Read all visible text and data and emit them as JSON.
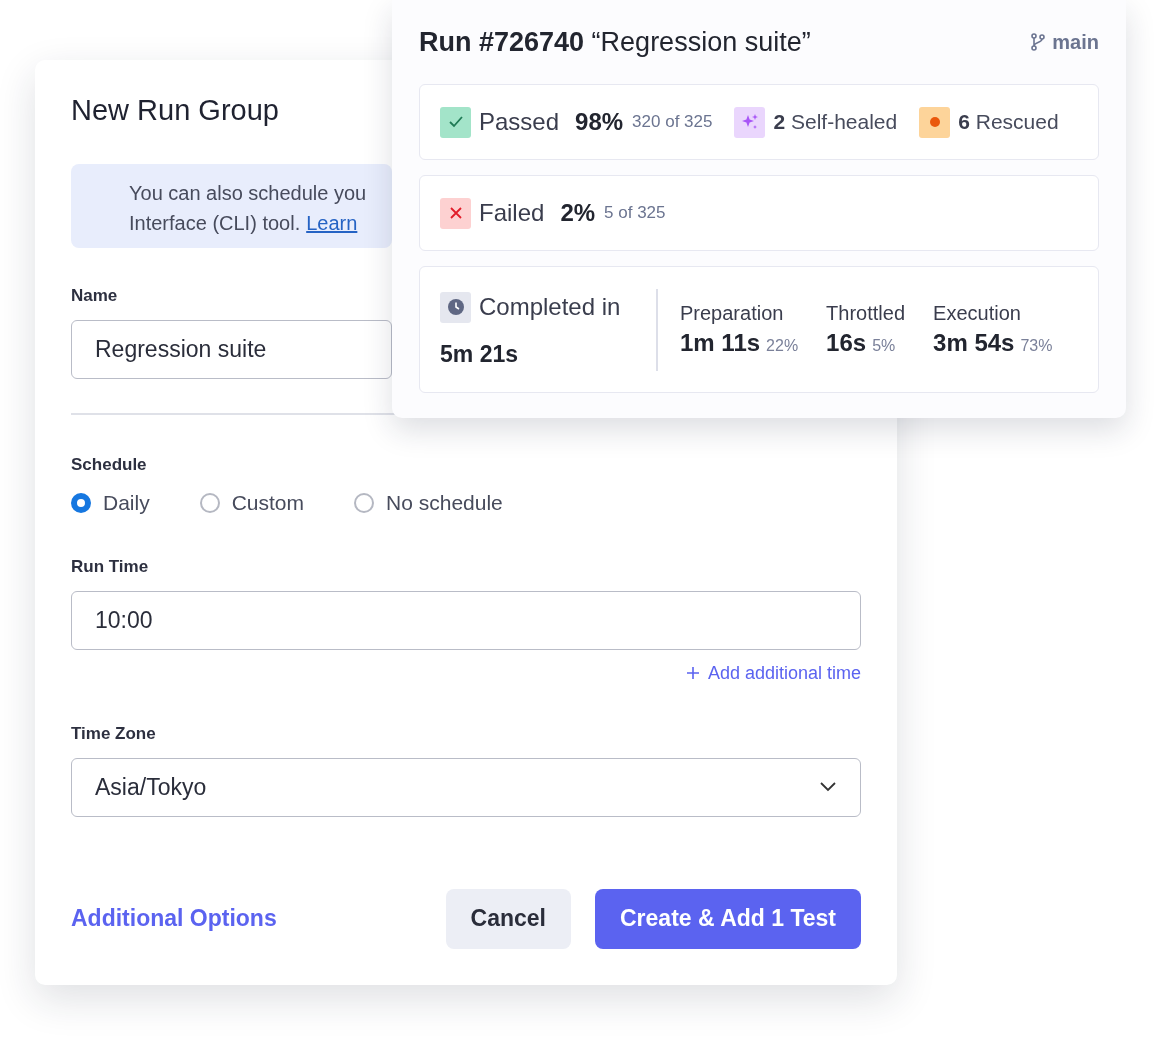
{
  "form": {
    "title": "New Run Group",
    "info": {
      "lines": [
        "You can also schedule you",
        "Interface (CLI) tool."
      ],
      "link": "Learn"
    },
    "name_field": {
      "label": "Name",
      "value": "Regression suite"
    },
    "schedule": {
      "label": "Schedule",
      "options": [
        {
          "label": "Daily",
          "selected": true
        },
        {
          "label": "Custom",
          "selected": false
        },
        {
          "label": "No schedule",
          "selected": false
        }
      ]
    },
    "run_time": {
      "label": "Run Time",
      "value": "10:00",
      "add_link": "Add additional time"
    },
    "time_zone": {
      "label": "Time Zone",
      "value": "Asia/Tokyo"
    },
    "footer": {
      "options_link": "Additional Options",
      "cancel": "Cancel",
      "submit": "Create & Add 1 Test"
    }
  },
  "run_panel": {
    "run": "Run #726740",
    "name": "“Regression suite”",
    "branch": "main",
    "passed": {
      "label": "Passed",
      "percent": "98%",
      "count": "320 of 325",
      "badges": [
        {
          "kind": "self_healed",
          "count": "2",
          "label": "Self-healed"
        },
        {
          "kind": "rescued",
          "count": "6",
          "label": "Rescued"
        }
      ]
    },
    "failed": {
      "label": "Failed",
      "percent": "2%",
      "count": "5 of 325"
    },
    "completed": {
      "label": "Completed in",
      "total": "5m 21s",
      "phases": [
        {
          "label": "Preparation",
          "value": "1m 11s",
          "share": "22%"
        },
        {
          "label": "Throttled",
          "value": "16s",
          "share": "5%"
        },
        {
          "label": "Execution",
          "value": "3m 54s",
          "share": "73%"
        }
      ]
    }
  }
}
